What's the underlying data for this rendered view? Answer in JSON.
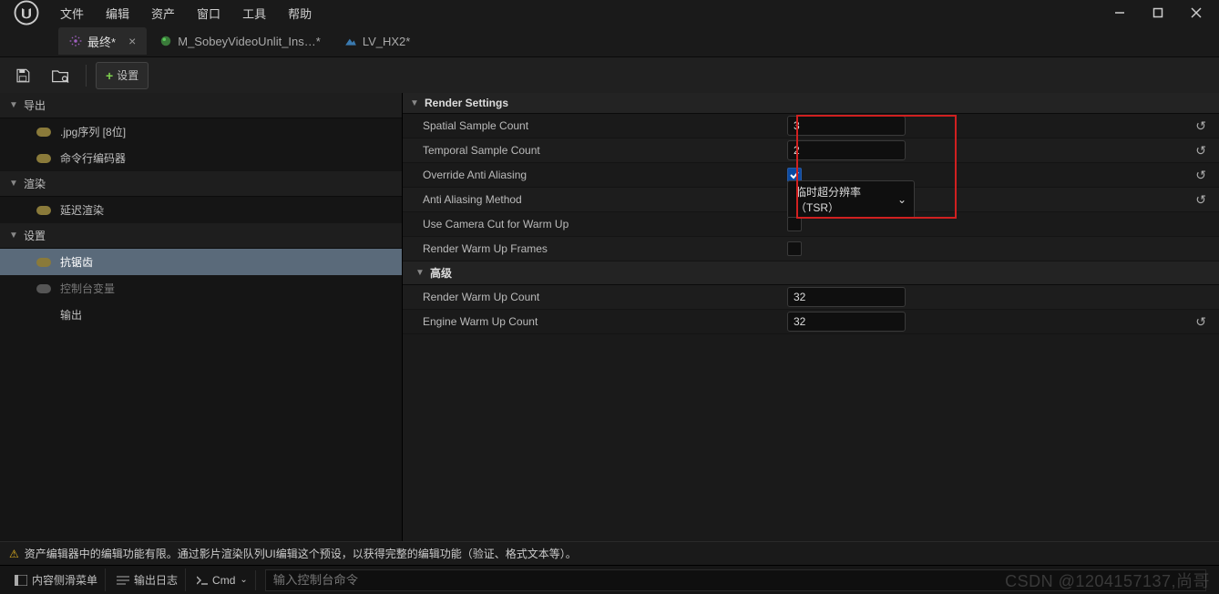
{
  "menu": [
    "文件",
    "编辑",
    "资产",
    "窗口",
    "工具",
    "帮助"
  ],
  "tabs": [
    {
      "label": "最终*",
      "icon": "gear",
      "active": true,
      "closable": true
    },
    {
      "label": "M_SobeyVideoUnlit_Ins…*",
      "icon": "material",
      "active": false,
      "closable": false
    },
    {
      "label": "LV_HX2*",
      "icon": "level",
      "active": false,
      "closable": false
    }
  ],
  "toolbar": {
    "settings_label": "设置"
  },
  "tree": {
    "sections": [
      {
        "label": "导出",
        "items": [
          {
            "label": ".jpg序列 [8位]",
            "on": true
          },
          {
            "label": "命令行编码器",
            "on": true
          }
        ]
      },
      {
        "label": "渲染",
        "items": [
          {
            "label": "延迟渲染",
            "on": true
          }
        ]
      },
      {
        "label": "设置",
        "items": [
          {
            "label": "抗锯齿",
            "on": true,
            "selected": true
          },
          {
            "label": "控制台变量",
            "on": false
          },
          {
            "label": "输出",
            "on": null
          }
        ]
      }
    ]
  },
  "details": {
    "header": "Render Settings",
    "rows": [
      {
        "label": "Spatial Sample Count",
        "type": "number",
        "value": "3",
        "reset": true
      },
      {
        "label": "Temporal Sample Count",
        "type": "number",
        "value": "2",
        "reset": true
      },
      {
        "label": "Override Anti Aliasing",
        "type": "check",
        "value": true,
        "reset": true
      },
      {
        "label": "Anti Aliasing Method",
        "type": "combo",
        "value": "临时超分辨率（TSR）",
        "reset": true
      },
      {
        "label": "Use Camera Cut for Warm Up",
        "type": "check",
        "value": false,
        "reset": false
      },
      {
        "label": "Render Warm Up Frames",
        "type": "check",
        "value": false,
        "reset": false
      }
    ],
    "advanced": {
      "label": "高级",
      "rows": [
        {
          "label": "Render Warm Up Count",
          "type": "number",
          "value": "32",
          "reset": false
        },
        {
          "label": "Engine Warm Up Count",
          "type": "number",
          "value": "32",
          "reset": true
        }
      ]
    }
  },
  "warning": "资产编辑器中的编辑功能有限。通过影片渲染队列UI编辑这个预设，以获得完整的编辑功能（验证、格式文本等）。",
  "bottom": {
    "content_drawer": "内容侧滑菜单",
    "output_log": "输出日志",
    "cmd_label": "Cmd",
    "cmd_placeholder": "输入控制台命令"
  },
  "watermark": "CSDN @1204157137,尚哥"
}
